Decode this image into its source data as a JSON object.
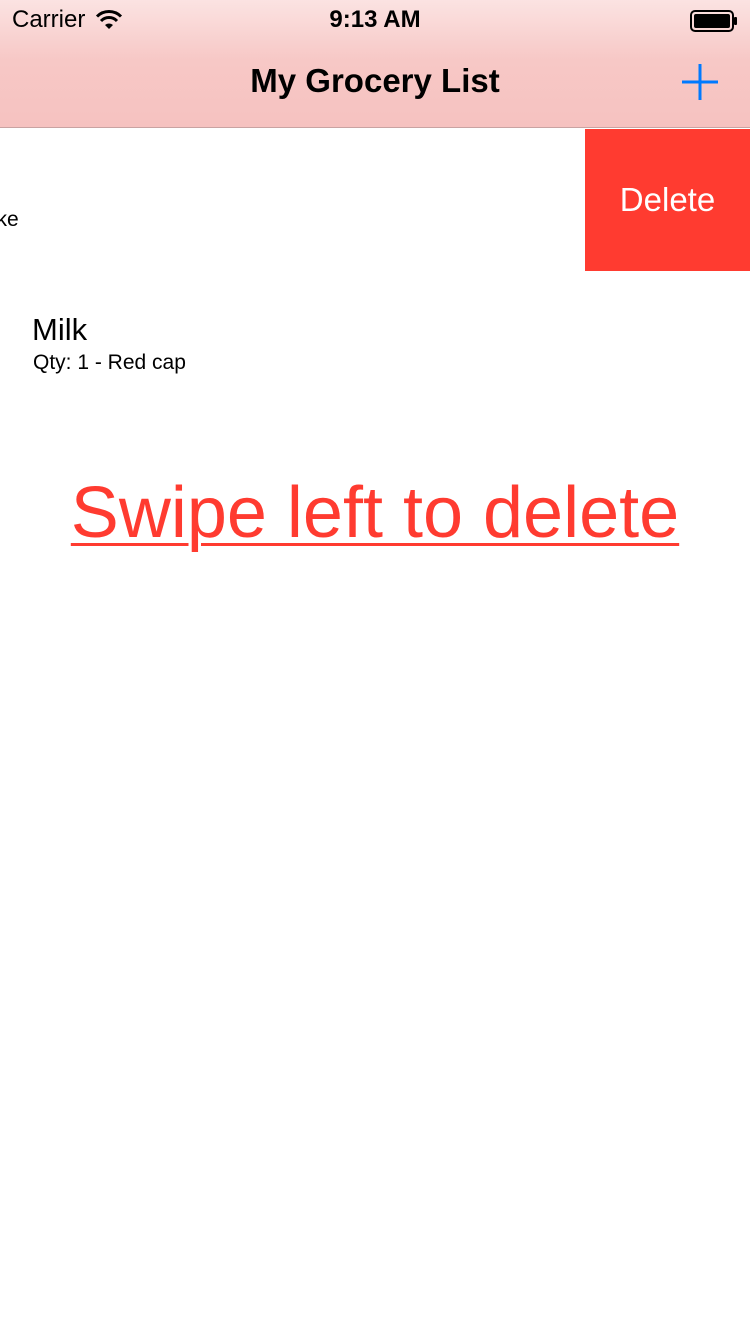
{
  "status_bar": {
    "carrier": "Carrier",
    "time": "9:13 AM",
    "wifi_icon": "wifi-icon",
    "battery_icon": "battery-icon"
  },
  "nav": {
    "title": "My Grocery List",
    "add_icon": "plus-icon",
    "tint_color": "#007aff"
  },
  "list": {
    "items": [
      {
        "title": "",
        "subtitle": "Strawberry cake",
        "swiped": true,
        "delete_label": "Delete"
      },
      {
        "title": "Milk",
        "subtitle": "Qty: 1 - Red cap",
        "swiped": false
      }
    ]
  },
  "hint": {
    "text": "Swipe left to delete",
    "color": "#ff3b30"
  },
  "colors": {
    "delete": "#ff3b30",
    "header_top": "#fbe3e2",
    "header_bottom": "#f6c2c0"
  }
}
